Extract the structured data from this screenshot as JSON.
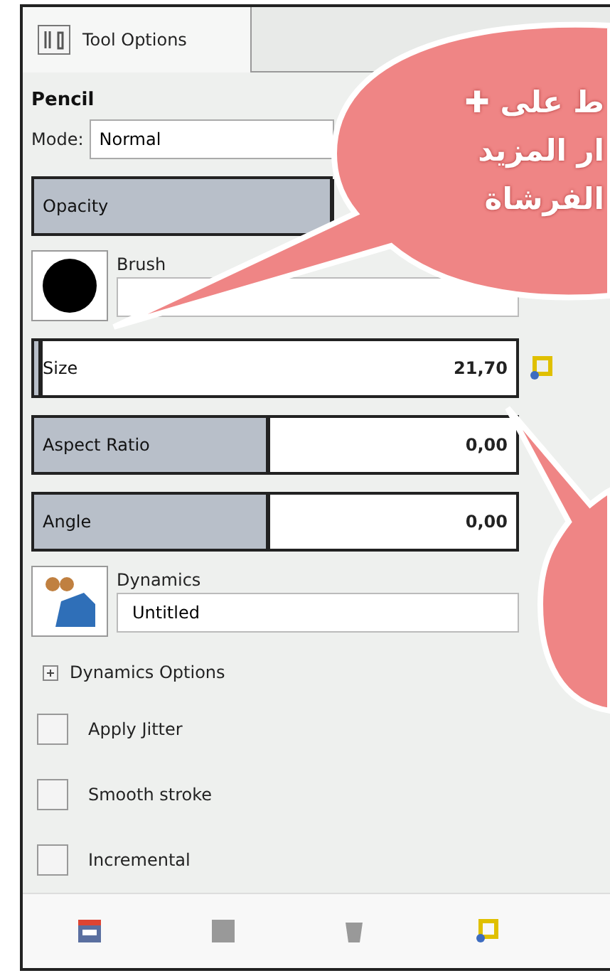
{
  "tab": {
    "label": "Tool Options",
    "selected": true
  },
  "tool_name": "Pencil",
  "mode": {
    "label": "Mode:",
    "value": "Normal"
  },
  "sliders": [
    {
      "label": "Opacity",
      "level": 1
    },
    {
      "label": "Size",
      "level": 0.01,
      "reading": "21,70"
    },
    {
      "label": "Aspect Ratio",
      "level": 0.48,
      "reading": "0,00"
    },
    {
      "label": "Angle",
      "level": 0.48,
      "reading": "0,00"
    }
  ],
  "brush": {
    "label": "Brush"
  },
  "dynamics": {
    "label": "Dynamics",
    "value": "Untitled"
  },
  "dynamics_options": {
    "label": "Dynamics Options",
    "expanded": false
  },
  "checkboxes": [
    {
      "label": "Apply Jitter",
      "checked": false
    },
    {
      "label": "Smooth stroke",
      "checked": false
    },
    {
      "label": "Incremental",
      "checked": false
    }
  ],
  "callout": {
    "lines": [
      "ط على ✚",
      "ار المزيد",
      "الفرشاة"
    ]
  }
}
